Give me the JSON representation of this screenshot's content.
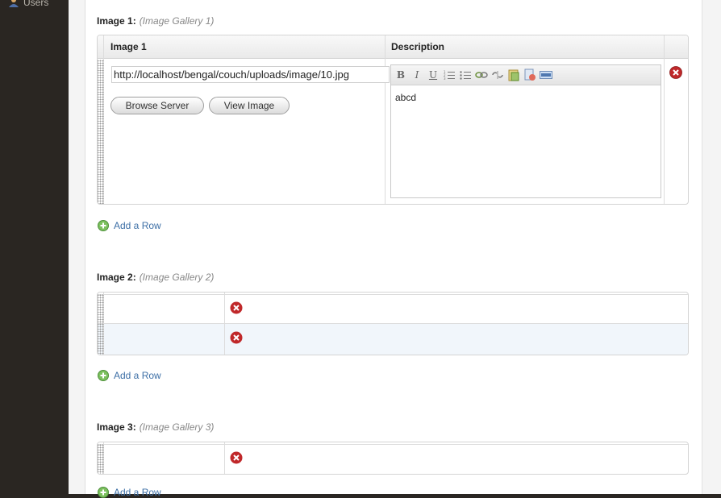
{
  "sidebar": {
    "users_label": "Users"
  },
  "fields": [
    {
      "label": "Image 1:",
      "sublabel": "(Image Gallery 1)",
      "columns": [
        "Image 1",
        "Description"
      ],
      "url_value": "http://localhost/bengal/couch/uploads/image/10.jpg",
      "browse_label": "Browse Server",
      "view_label": "View Image",
      "description_text": "abcd",
      "add_row_label": "Add a Row"
    },
    {
      "label": "Image 2:",
      "sublabel": "(Image Gallery 2)",
      "add_row_label": "Add a Row"
    },
    {
      "label": "Image 3:",
      "sublabel": "(Image Gallery 3)",
      "add_row_label": "Add a Row"
    }
  ],
  "toolbar_icons": [
    "bold-icon",
    "italic-icon",
    "underline-icon",
    "numbered-list-icon",
    "bulleted-list-icon",
    "link-icon",
    "unlink-icon",
    "paste-word-icon",
    "spellcheck-icon",
    "source-icon"
  ],
  "colors": {
    "link": "#3d6fa6",
    "delete": "#c0282a",
    "add": "#5aa84a",
    "sidebar": "#2a2622"
  }
}
